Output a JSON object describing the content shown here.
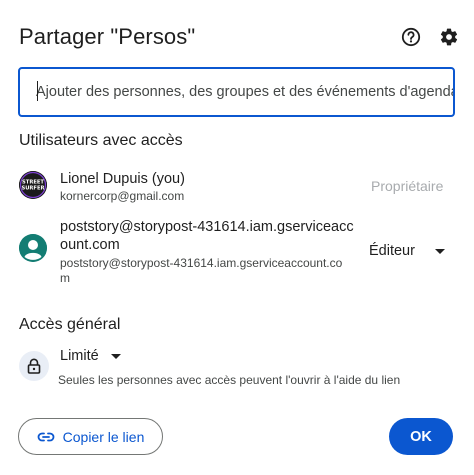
{
  "dialog": {
    "title": "Partager \"Persos\"",
    "help_icon": "help-circle-icon",
    "settings_icon": "gear-icon"
  },
  "invite": {
    "placeholder": "Ajouter des personnes, des groupes et des événements d'agenda",
    "value": ""
  },
  "users_section": {
    "heading": "Utilisateurs avec accès",
    "users": [
      {
        "name": "Lionel Dupuis (you)",
        "email": "kornercorp@gmail.com",
        "role": "Propriétaire",
        "avatar_text": "STREET SURFER"
      },
      {
        "name_line1": "poststory@storypost-431614.iam.gserviceacc",
        "name_line2": "ount.com",
        "email_line1": "poststory@storypost-431614.iam.gserviceaccount.co",
        "email_line2": "m",
        "role": "Éditeur",
        "avatar_icon": "person-icon"
      }
    ]
  },
  "general_access": {
    "heading": "Accès général",
    "level": "Limité",
    "description": "Seules les personnes avec accès peuvent l'ouvrir à l'aide du lien",
    "icon": "lock-icon"
  },
  "footer": {
    "copy_link_label": "Copier le lien",
    "copy_icon": "link-icon",
    "ok_label": "OK"
  },
  "colors": {
    "primary": "#0b57d0",
    "text": "#1f1f1f",
    "secondary_text": "#444746",
    "disabled_text": "#a8abae",
    "service_avatar": "#137d73"
  }
}
